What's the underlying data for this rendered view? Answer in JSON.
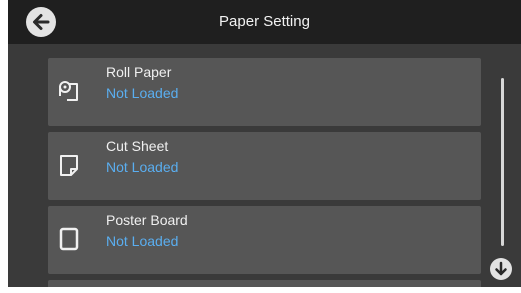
{
  "header": {
    "title": "Paper Setting",
    "back_icon": "arrow-left-icon"
  },
  "paper_sources": [
    {
      "name": "Roll Paper",
      "status": "Not Loaded",
      "icon": "roll-paper-icon"
    },
    {
      "name": "Cut Sheet",
      "status": "Not Loaded",
      "icon": "cut-sheet-icon"
    },
    {
      "name": "Poster Board",
      "status": "Not Loaded",
      "icon": "poster-board-icon"
    }
  ],
  "scroll": {
    "down_icon": "arrow-down-icon"
  },
  "colors": {
    "header_bg": "#1f1f1f",
    "screen_bg": "#3a3a3a",
    "item_bg": "#565656",
    "status_text": "#5aaef0",
    "label_text": "#f0f0f0"
  }
}
